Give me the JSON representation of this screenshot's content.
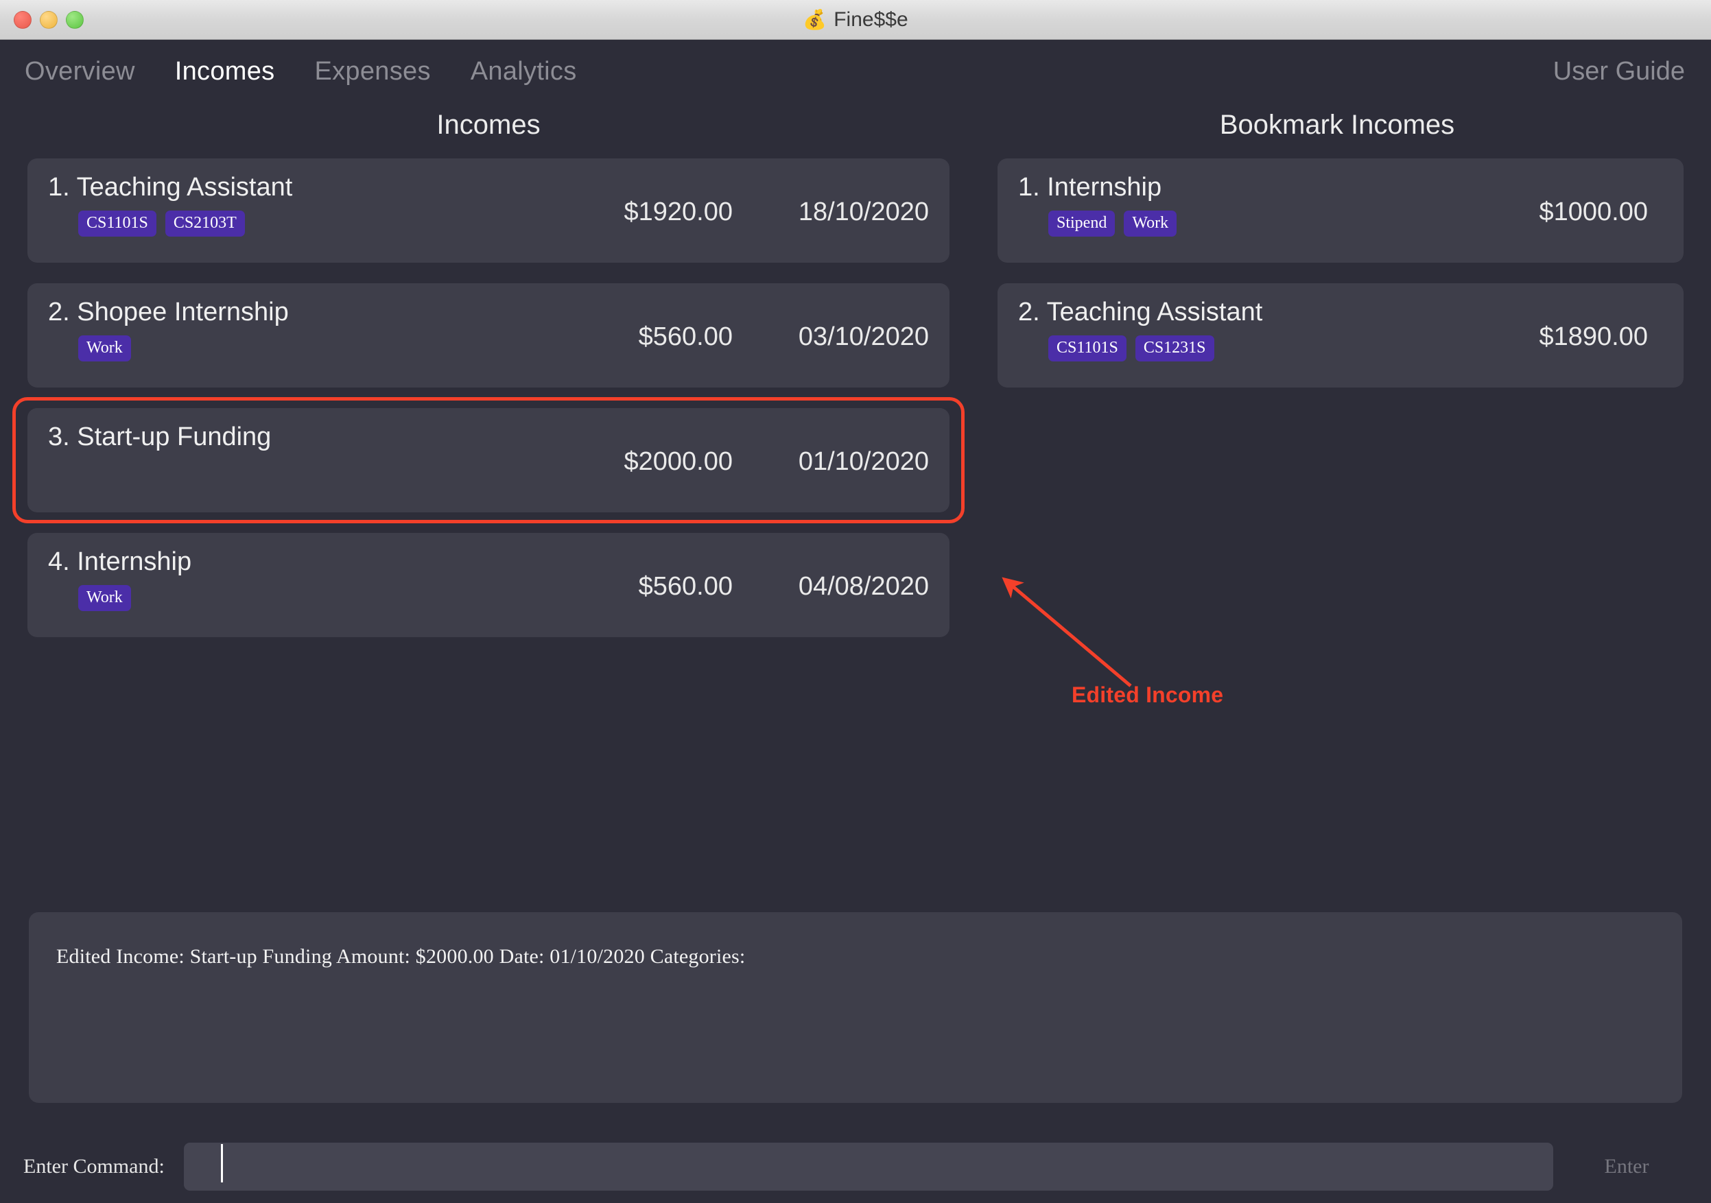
{
  "window": {
    "title": "Fine$$e",
    "icon": "money-bag-emoji",
    "emoji": "💰"
  },
  "nav": {
    "tabs": [
      {
        "label": "Overview",
        "active": false
      },
      {
        "label": "Incomes",
        "active": true
      },
      {
        "label": "Expenses",
        "active": false
      },
      {
        "label": "Analytics",
        "active": false
      }
    ],
    "user_guide": "User Guide"
  },
  "incomes_panel": {
    "title": "Incomes",
    "items": [
      {
        "index": "1.",
        "name": "Teaching Assistant",
        "title": "1. Teaching Assistant",
        "tags": [
          "CS1101S",
          "CS2103T"
        ],
        "amount": "$1920.00",
        "date": "18/10/2020",
        "highlighted": false
      },
      {
        "index": "2.",
        "name": "Shopee Internship",
        "title": "2. Shopee Internship",
        "tags": [
          "Work"
        ],
        "amount": "$560.00",
        "date": "03/10/2020",
        "highlighted": false
      },
      {
        "index": "3.",
        "name": "Start-up Funding",
        "title": "3. Start-up Funding",
        "tags": [],
        "amount": "$2000.00",
        "date": "01/10/2020",
        "highlighted": true
      },
      {
        "index": "4.",
        "name": "Internship",
        "title": "4. Internship",
        "tags": [
          "Work"
        ],
        "amount": "$560.00",
        "date": "04/08/2020",
        "highlighted": false
      }
    ]
  },
  "bookmark_panel": {
    "title": "Bookmark Incomes",
    "items": [
      {
        "index": "1.",
        "name": "Internship",
        "title": "1. Internship",
        "tags": [
          "Stipend",
          "Work"
        ],
        "amount": "$1000.00"
      },
      {
        "index": "2.",
        "name": "Teaching Assistant",
        "title": "2. Teaching Assistant",
        "tags": [
          "CS1101S",
          "CS1231S"
        ],
        "amount": "$1890.00"
      }
    ]
  },
  "annotation": {
    "label": "Edited Income",
    "color": "#f4402a",
    "target": "income-card-3"
  },
  "result_box": {
    "text": "Edited Income: Start-up Funding Amount: $2000.00 Date: 01/10/2020 Categories:"
  },
  "command_bar": {
    "label": "Enter Command:",
    "value": "",
    "placeholder": "",
    "button_label": "Enter"
  },
  "colors": {
    "background": "#2d2d39",
    "card": "#3e3e4a",
    "tag": "#4b2ea8",
    "accent_annotation": "#f4402a",
    "text_primary": "#f0f0f0",
    "text_muted": "#8d8d95"
  }
}
